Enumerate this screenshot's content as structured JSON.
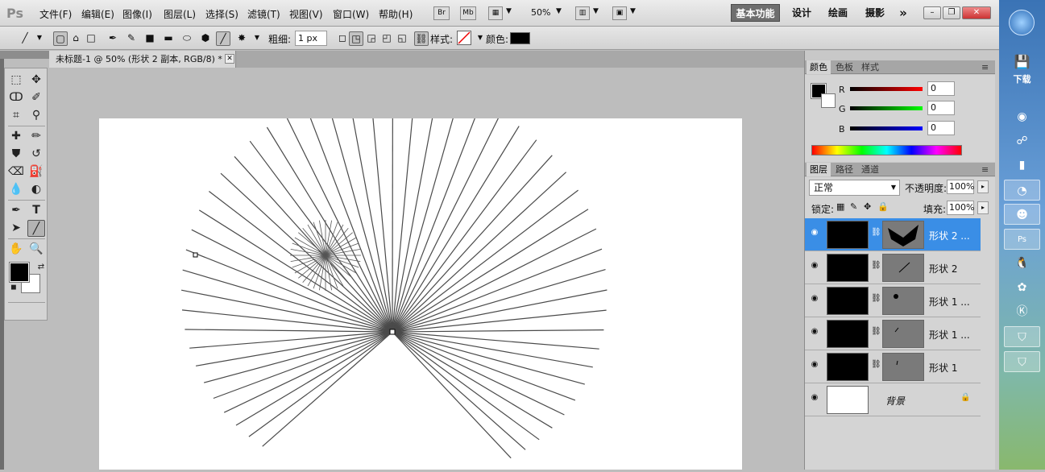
{
  "menubar": {
    "logo": "Ps",
    "items": [
      "文件(F)",
      "编辑(E)",
      "图像(I)",
      "图层(L)",
      "选择(S)",
      "滤镜(T)",
      "视图(V)",
      "窗口(W)",
      "帮助(H)"
    ],
    "bridge": "Br",
    "minibridge": "Mb",
    "zoom": "50%",
    "workspaces": [
      "基本功能",
      "设计",
      "绘画",
      "摄影"
    ],
    "more": "»",
    "window_buttons": [
      "–",
      "❐",
      "✕"
    ]
  },
  "options": {
    "weight_label": "粗细:",
    "weight_value": "1 px",
    "style_label": "样式:",
    "color_label": "颜色:"
  },
  "document": {
    "tab_title": "未标题-1 @ 50% (形状 2 副本, RGB/8) *",
    "close": "✕"
  },
  "color_panel": {
    "tabs": [
      "颜色",
      "色板",
      "样式"
    ],
    "channels": [
      {
        "label": "R",
        "value": "0",
        "color": "#d00000"
      },
      {
        "label": "G",
        "value": "0",
        "color": "#00b000"
      },
      {
        "label": "B",
        "value": "0",
        "color": "#0000d0"
      }
    ]
  },
  "layers_panel": {
    "tabs": [
      "图层",
      "路径",
      "通道"
    ],
    "blend_mode": "正常",
    "opacity_label": "不透明度:",
    "opacity_value": "100%",
    "lock_label": "锁定:",
    "fill_label": "填充:",
    "fill_value": "100%",
    "layers": [
      {
        "name": "形状 2 ...",
        "selected": true
      },
      {
        "name": "形状 2",
        "selected": false
      },
      {
        "name": "形状 1 ...",
        "selected": false
      },
      {
        "name": "形状 1 ...",
        "selected": false
      },
      {
        "name": "形状 1",
        "selected": false
      },
      {
        "name": "背景",
        "selected": false
      }
    ]
  },
  "taskbar": {
    "download_label": "下载"
  },
  "canvas": {
    "fan_lines": 52,
    "small_burst_lines": 36
  }
}
